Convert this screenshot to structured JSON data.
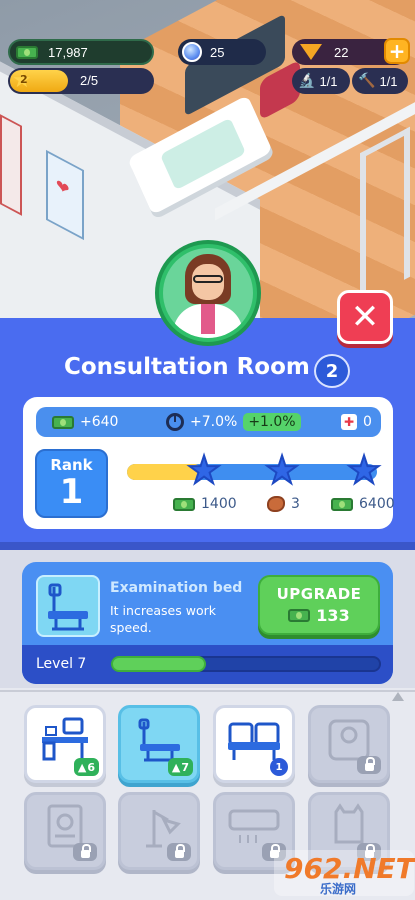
{
  "hud": {
    "cash": "17,987",
    "gems": "25",
    "diamonds": "22",
    "level_star": "2",
    "level_progress": "2/5",
    "microscopes": "1/1",
    "hammers": "1/1",
    "plus_label": "+"
  },
  "room": {
    "title": "Consultation Room",
    "level": "2",
    "close_label": "✕"
  },
  "stats": {
    "income": "+640",
    "speed": "+7.0%",
    "speed_bonus": "+1.0%",
    "heal": "0"
  },
  "rank": {
    "label": "Rank",
    "value": "1",
    "progress": 0.3,
    "rewards": [
      {
        "value": "1400",
        "icon": "cash-icon"
      },
      {
        "value": "3",
        "icon": "meat-icon"
      },
      {
        "value": "6400",
        "icon": "cash-icon"
      }
    ]
  },
  "upgrade": {
    "item_name": "Examination bed",
    "item_desc": "It increases work speed.",
    "button_label": "UPGRADE",
    "cost": "133",
    "level_label": "Level 7",
    "level_progress": 0.35
  },
  "grid": {
    "tiles": [
      {
        "name": "desk",
        "state": "owned",
        "badge": "6",
        "badge_arrow": "▲"
      },
      {
        "name": "examination-bed",
        "state": "selected",
        "badge": "7",
        "badge_arrow": "▲"
      },
      {
        "name": "waiting-seats",
        "state": "owned",
        "count": "1"
      },
      {
        "name": "scale",
        "state": "locked"
      },
      {
        "name": "certificate",
        "state": "locked"
      },
      {
        "name": "lamp",
        "state": "locked"
      },
      {
        "name": "air-conditioner",
        "state": "locked"
      },
      {
        "name": "cat-statue",
        "state": "locked"
      }
    ]
  },
  "watermark": {
    "main": "962.NET",
    "sub": "乐游网"
  },
  "colors": {
    "panel_blue": "#4a6cf0",
    "upgrade_green": "#5fd05a",
    "close_red": "#ef3e54",
    "star_yellow": "#ffd24a"
  }
}
